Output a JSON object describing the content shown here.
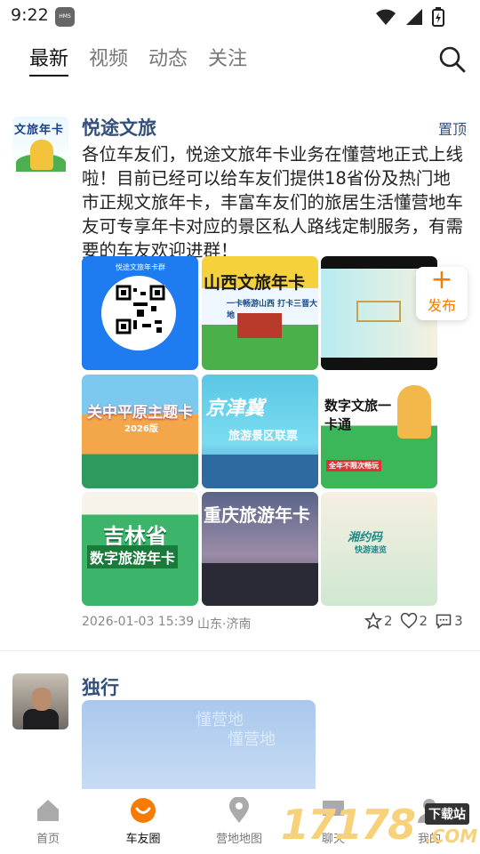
{
  "status": {
    "time": "9:22",
    "hms_badge": "HMS"
  },
  "tabs": [
    {
      "label": "最新",
      "active": true
    },
    {
      "label": "视频",
      "active": false
    },
    {
      "label": "动态",
      "active": false
    },
    {
      "label": "关注",
      "active": false
    }
  ],
  "post1": {
    "author": "悦途文旅",
    "pinned_label": "置顶",
    "avatar_text": "文旅年卡",
    "content": "各位车友们，悦途文旅年卡业务在懂营地正式上线啦！目前已经可以给车友们提供18省份及热门地市正规文旅年卡，丰富车友们的旅居生活懂营地车友可专享年卡对应的景区私人路线定制服务，有需要的车友欢迎进群！",
    "images": [
      {
        "caption": "悦途文旅年卡群"
      },
      {
        "caption": "山西文旅年卡",
        "sub": "一卡畅游山西 打卡三晋大地"
      },
      {
        "caption": ""
      },
      {
        "caption": "关中平原主题卡",
        "sub": "2026版"
      },
      {
        "caption": "京津冀",
        "sub": "旅游景区联票"
      },
      {
        "caption": "数字文旅一卡通",
        "sub": "全年不限次畅玩"
      },
      {
        "caption": "吉林省",
        "sub": "数字旅游年卡"
      },
      {
        "caption": "重庆旅游年卡"
      },
      {
        "caption": "湘约码",
        "sub": "快游速览"
      }
    ],
    "datetime": "2026-01-03 15:39",
    "location": "山东·济南",
    "stars": "2",
    "likes": "2",
    "comments": "3"
  },
  "publish": {
    "label": "发布"
  },
  "post2": {
    "author": "独行",
    "watermark": "懂营地"
  },
  "nav": [
    {
      "label": "首页",
      "icon": "home-icon",
      "active": false
    },
    {
      "label": "车友圈",
      "icon": "circle-icon",
      "active": true
    },
    {
      "label": "营地地图",
      "icon": "map-pin-icon",
      "active": false
    },
    {
      "label": "聊天",
      "icon": "chat-icon",
      "active": false
    },
    {
      "label": "我的",
      "icon": "profile-icon",
      "active": false
    }
  ],
  "site_watermark": {
    "text": "17178",
    "badge": "下载站",
    "domain": ".COM"
  },
  "colors": {
    "accent": "#f57c00",
    "username": "#33507a"
  }
}
